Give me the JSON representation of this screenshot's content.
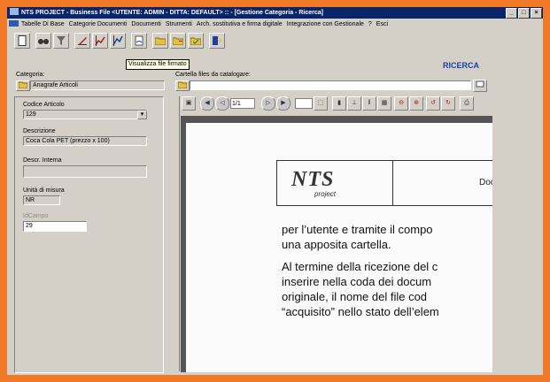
{
  "title": {
    "text": "NTS PROJECT - Business File     <UTENTE: ADMIN  -  DITTA: DEFAULT> :: - [Gestione Categoria - Ricerca]",
    "controls": [
      "_",
      "□",
      "×"
    ]
  },
  "menu": [
    "Tabelle Di Base",
    "Categorie Documenti",
    "Documenti",
    "Strumenti",
    "Arch. sostitutiva e firma digitale",
    "Integrazione con Gestionale",
    "?",
    "Esci"
  ],
  "toolbar": {
    "icons": [
      "new-document-icon",
      "search-binoculars-icon",
      "filter-icon",
      "edit-icon",
      "chart-icon",
      "chart-edit-icon",
      "signed-file-icon",
      "folder-open-icon",
      "folder-add-icon",
      "folder-check-icon",
      "export-icon"
    ],
    "tooltip": "Visualizza file firmato"
  },
  "header": {
    "ricerca": "RICERCA"
  },
  "categoria": {
    "label": "Categoria:",
    "value": "Anagrafe Articoli"
  },
  "cartella": {
    "label": "Cartella files da catalogare:",
    "value": ""
  },
  "fields": {
    "codice_label": "Codice Articolo",
    "codice_value": "129",
    "descrizione_label": "Descrizione",
    "descrizione_value": "Coca Cola PET (prezzo x 100)",
    "descr_interna_label": "Descr. Interna",
    "descr_interna_value": "",
    "unita_label": "Unità di misura",
    "unita_value": "NR",
    "idcampo_label": "IdCampo",
    "idcampo_value": "29"
  },
  "viewer": {
    "page_display": "1/1",
    "zoom_value": ""
  },
  "document": {
    "logo": "NTS",
    "logo_sub": "project",
    "header_text": "Docu",
    "lines": [
      "per l’utente e tramite il compo",
      "una apposita cartella.",
      "",
      "Al termine della ricezione del c",
      "inserire nella coda dei docum",
      "originale, il nome del file cod",
      "“acquisito” nello stato dell’elem"
    ]
  }
}
